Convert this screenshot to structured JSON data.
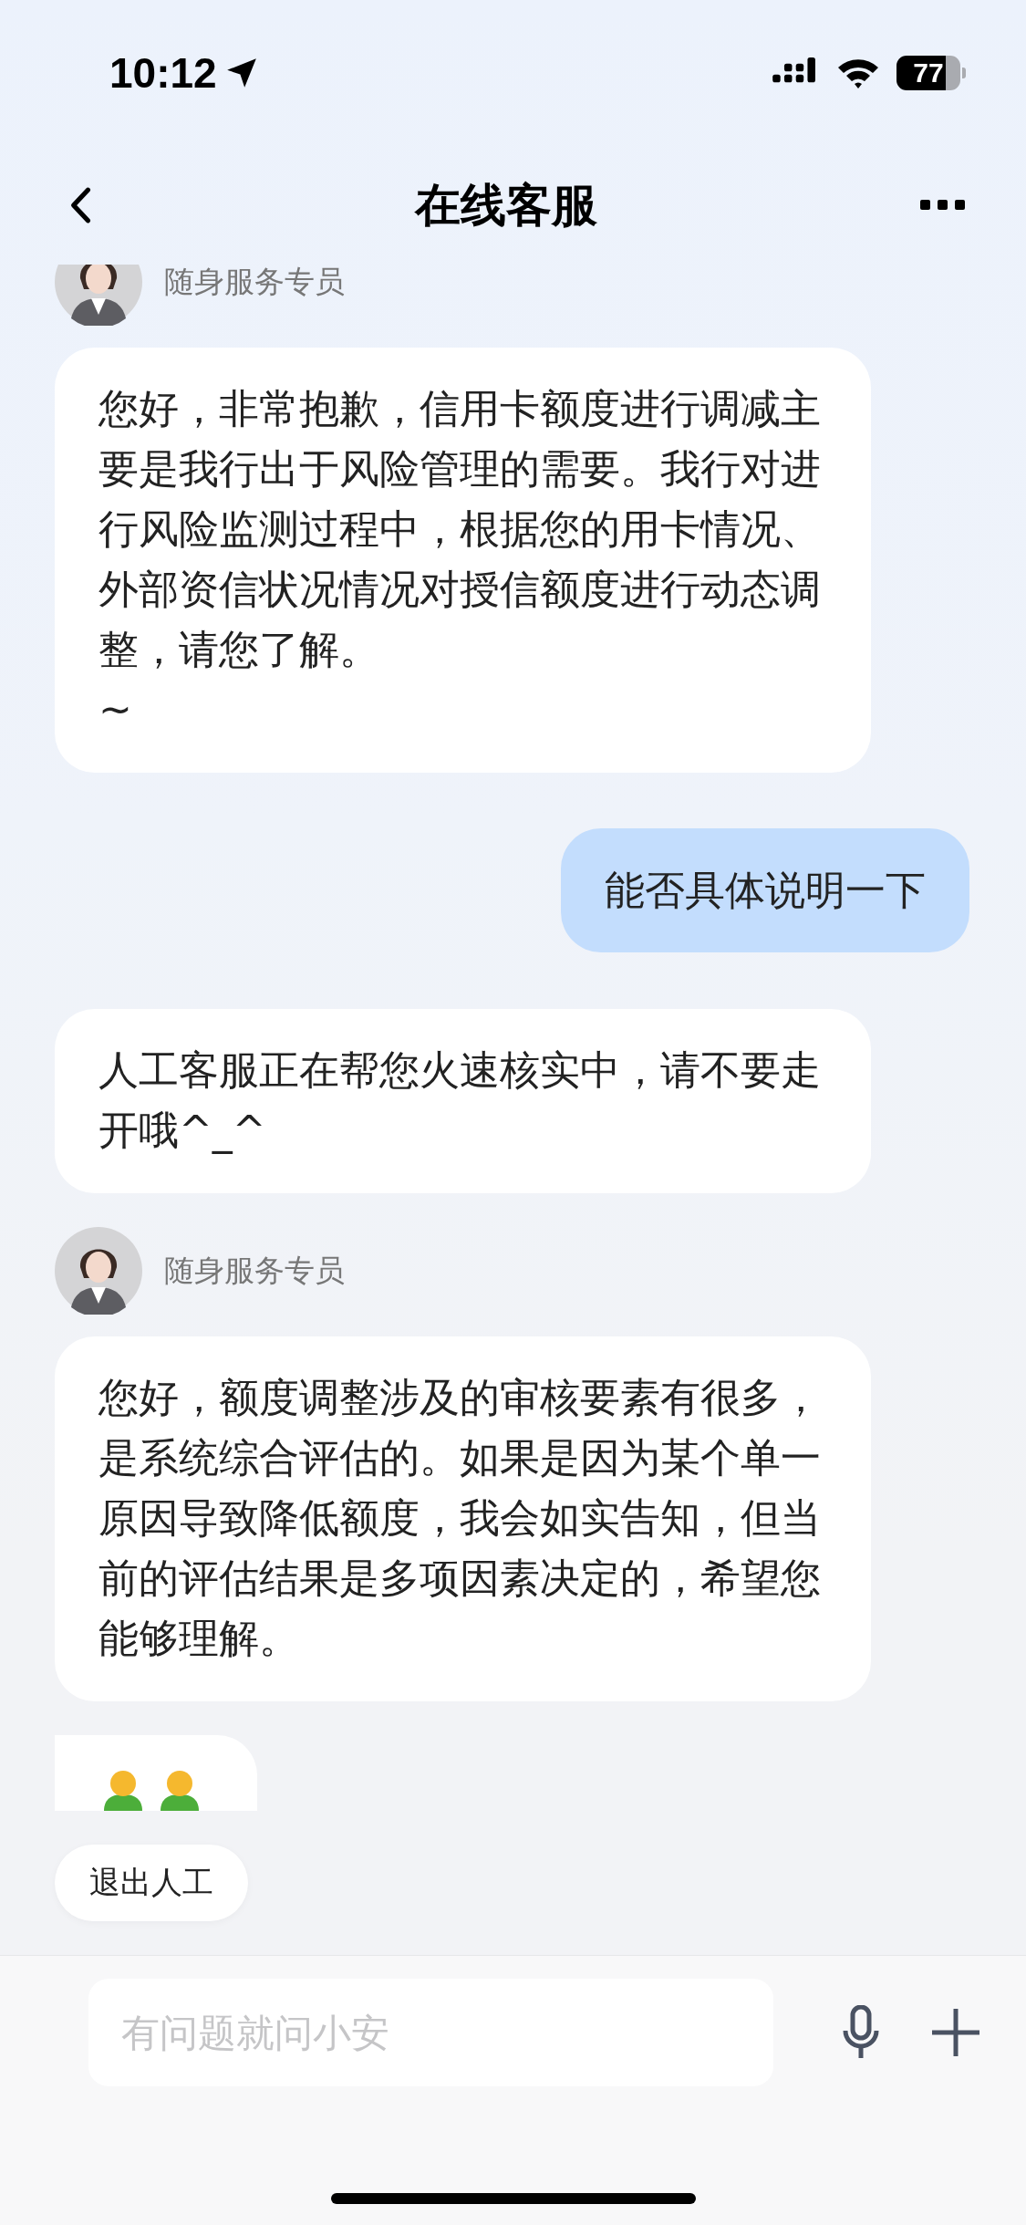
{
  "status_bar": {
    "time": "10:12",
    "battery": "77"
  },
  "header": {
    "title": "在线客服"
  },
  "messages": [
    {
      "kind": "agent_label",
      "name": "随身服务专员"
    },
    {
      "kind": "agent",
      "text": "您好，非常抱歉，信用卡额度进行调减主要是我行出于风险管理的需要。我行对进行风险监测过程中，根据您的用卡情况、外部资信状况情况对授信额度进行动态调整，请您了解。\n~"
    },
    {
      "kind": "user",
      "text": "能否具体说明一下"
    },
    {
      "kind": "agent",
      "text": "人工客服正在帮您火速核实中，请不要走开哦^_^"
    },
    {
      "kind": "agent_label",
      "name": "随身服务专员"
    },
    {
      "kind": "agent",
      "text": "您好，额度调整涉及的审核要素有很多，是系统综合评估的。如果是因为某个单一原因导致降低额度，我会如实告知，但当前的评估结果是多项因素决定的，希望您能够理解。"
    },
    {
      "kind": "emoji"
    }
  ],
  "quick_action": "退出人工",
  "input": {
    "placeholder": "有问题就问小安"
  }
}
